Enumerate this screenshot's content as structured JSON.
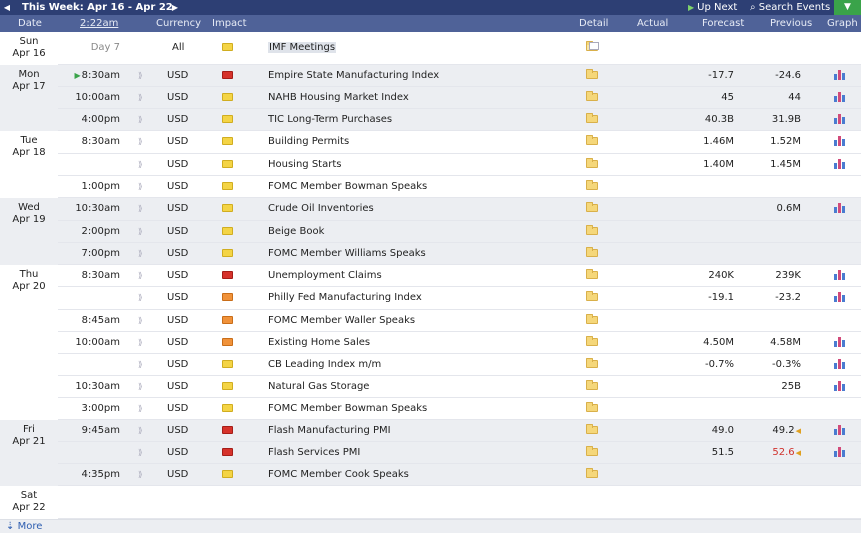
{
  "topbar": {
    "prev_icon": "◀",
    "title": "This Week: Apr 16 - Apr 22",
    "next_icon": "▶",
    "up_next": "Up Next",
    "search": "Search Events",
    "filter_icon": "filter-icon"
  },
  "header": {
    "date": "Date",
    "time": "2:22am",
    "currency": "Currency",
    "impact": "Impact",
    "detail": "Detail",
    "actual": "Actual",
    "forecast": "Forecast",
    "previous": "Previous",
    "graph": "Graph"
  },
  "days": [
    {
      "dow": "Sun",
      "date": "Apr 16"
    },
    {
      "dow": "Mon",
      "date": "Apr 17"
    },
    {
      "dow": "Tue",
      "date": "Apr 18"
    },
    {
      "dow": "Wed",
      "date": "Apr 19"
    },
    {
      "dow": "Thu",
      "date": "Apr 20"
    },
    {
      "dow": "Fri",
      "date": "Apr 21"
    },
    {
      "dow": "Sat",
      "date": "Apr 22"
    }
  ],
  "events": [
    {
      "time": "Day 7",
      "currency": "All",
      "impact": "low",
      "event": "IMF Meetings",
      "forecast": "",
      "previous": "",
      "graph": false
    },
    {
      "time": "8:30am",
      "currency": "USD",
      "impact": "high",
      "event": "Empire State Manufacturing Index",
      "forecast": "-17.7",
      "previous": "-24.6",
      "graph": true
    },
    {
      "time": "10:00am",
      "currency": "USD",
      "impact": "low",
      "event": "NAHB Housing Market Index",
      "forecast": "45",
      "previous": "44",
      "graph": true
    },
    {
      "time": "4:00pm",
      "currency": "USD",
      "impact": "low",
      "event": "TIC Long-Term Purchases",
      "forecast": "40.3B",
      "previous": "31.9B",
      "graph": true
    },
    {
      "time": "8:30am",
      "currency": "USD",
      "impact": "low",
      "event": "Building Permits",
      "forecast": "1.46M",
      "previous": "1.52M",
      "graph": true
    },
    {
      "time": "",
      "currency": "USD",
      "impact": "low",
      "event": "Housing Starts",
      "forecast": "1.40M",
      "previous": "1.45M",
      "graph": true
    },
    {
      "time": "1:00pm",
      "currency": "USD",
      "impact": "low",
      "event": "FOMC Member Bowman Speaks",
      "forecast": "",
      "previous": "",
      "graph": false
    },
    {
      "time": "10:30am",
      "currency": "USD",
      "impact": "low",
      "event": "Crude Oil Inventories",
      "forecast": "",
      "previous": "0.6M",
      "graph": true
    },
    {
      "time": "2:00pm",
      "currency": "USD",
      "impact": "low",
      "event": "Beige Book",
      "forecast": "",
      "previous": "",
      "graph": false
    },
    {
      "time": "7:00pm",
      "currency": "USD",
      "impact": "low",
      "event": "FOMC Member Williams Speaks",
      "forecast": "",
      "previous": "",
      "graph": false
    },
    {
      "time": "8:30am",
      "currency": "USD",
      "impact": "high",
      "event": "Unemployment Claims",
      "forecast": "240K",
      "previous": "239K",
      "graph": true
    },
    {
      "time": "",
      "currency": "USD",
      "impact": "med",
      "event": "Philly Fed Manufacturing Index",
      "forecast": "-19.1",
      "previous": "-23.2",
      "graph": true
    },
    {
      "time": "8:45am",
      "currency": "USD",
      "impact": "med",
      "event": "FOMC Member Waller Speaks",
      "forecast": "",
      "previous": "",
      "graph": false
    },
    {
      "time": "10:00am",
      "currency": "USD",
      "impact": "med",
      "event": "Existing Home Sales",
      "forecast": "4.50M",
      "previous": "4.58M",
      "graph": true
    },
    {
      "time": "",
      "currency": "USD",
      "impact": "low",
      "event": "CB Leading Index m/m",
      "forecast": "-0.7%",
      "previous": "-0.3%",
      "graph": true
    },
    {
      "time": "10:30am",
      "currency": "USD",
      "impact": "low",
      "event": "Natural Gas Storage",
      "forecast": "",
      "previous": "25B",
      "graph": true
    },
    {
      "time": "3:00pm",
      "currency": "USD",
      "impact": "low",
      "event": "FOMC Member Bowman Speaks",
      "forecast": "",
      "previous": "",
      "graph": false
    },
    {
      "time": "9:45am",
      "currency": "USD",
      "impact": "high",
      "event": "Flash Manufacturing PMI",
      "forecast": "49.0",
      "previous": "49.2",
      "graph": true
    },
    {
      "time": "",
      "currency": "USD",
      "impact": "high",
      "event": "Flash Services PMI",
      "forecast": "51.5",
      "previous": "52.6",
      "graph": true
    },
    {
      "time": "4:35pm",
      "currency": "USD",
      "impact": "low",
      "event": "FOMC Member Cook Speaks",
      "forecast": "",
      "previous": "",
      "graph": false
    }
  ],
  "footer": {
    "more": "More"
  },
  "colors": {
    "topbar": "#2d3f74",
    "header": "#4f6298",
    "high": "#d6322b",
    "medium": "#f0923a",
    "low": "#f4d445",
    "revised_red": "#d0312d"
  }
}
